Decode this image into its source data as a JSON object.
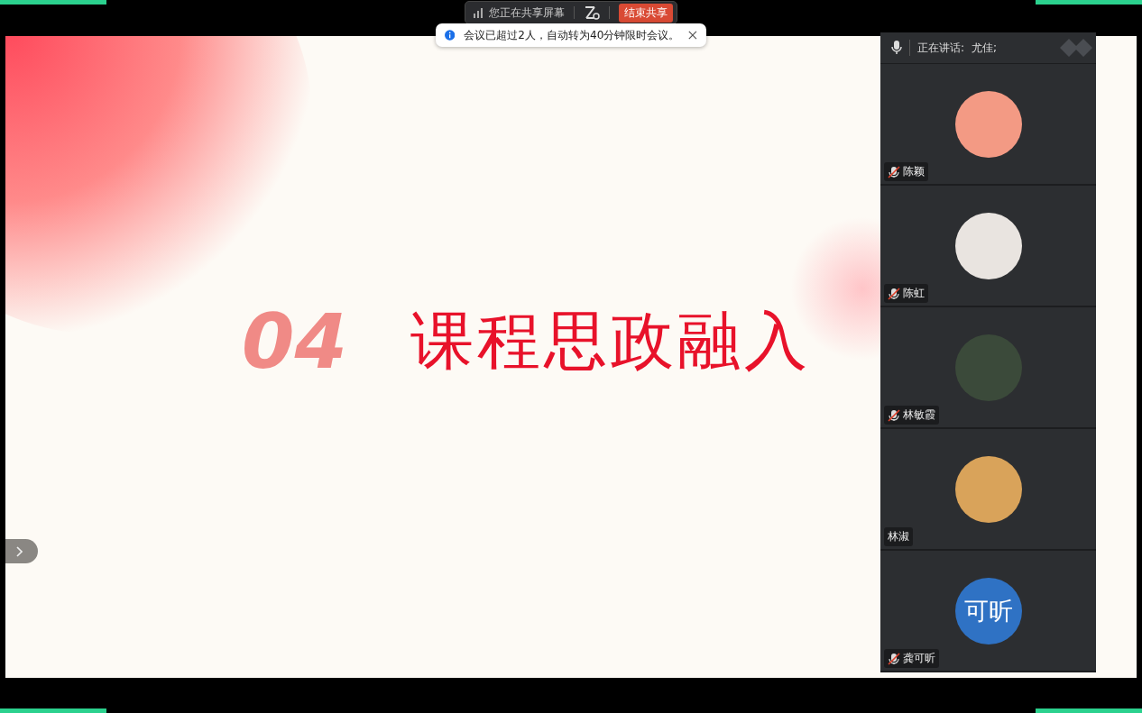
{
  "share_bar": {
    "status": "您正在共享屏幕",
    "stop_button": "结束共享"
  },
  "notice": {
    "text": "会议已超过2人，自动转为40分钟限时会议。"
  },
  "slide": {
    "number": "04",
    "title": "课程思政融入"
  },
  "speaker_panel": {
    "label": "正在讲话:",
    "speaker": "尤佳;"
  },
  "participants": [
    {
      "name": "陈颖",
      "muted": true,
      "avatar": {
        "kind": "image",
        "color": "#f39a84"
      }
    },
    {
      "name": "陈虹",
      "muted": true,
      "avatar": {
        "kind": "image",
        "color": "#e9e4e0"
      }
    },
    {
      "name": "林敏霞",
      "muted": true,
      "avatar": {
        "kind": "image",
        "color": "#3b4a3a"
      }
    },
    {
      "name": "林淑",
      "muted": false,
      "avatar": {
        "kind": "image",
        "color": "#d9a35a"
      }
    },
    {
      "name": "龚可昕",
      "muted": true,
      "avatar": {
        "kind": "text",
        "text": "可昕",
        "color": "#2f72c4"
      }
    }
  ]
}
